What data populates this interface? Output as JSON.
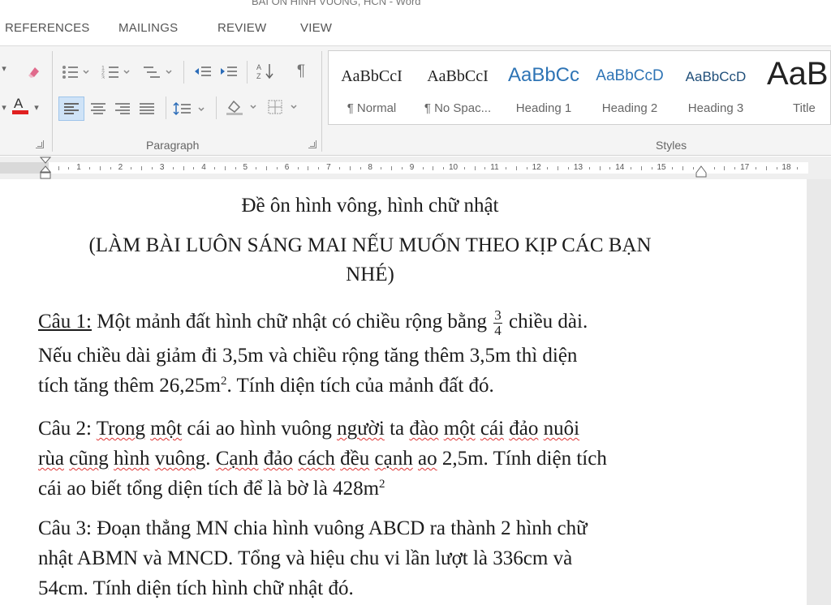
{
  "window": {
    "title": "BÀI ÔN HÌNH VUÔNG, HCN - Word"
  },
  "tabs": [
    "REFERENCES",
    "MAILINGS",
    "REVIEW",
    "VIEW"
  ],
  "ribbon": {
    "paragraph_label": "Paragraph",
    "styles_label": "Styles",
    "pilcrow": "¶",
    "styles": [
      {
        "sample": "AaBbCcI",
        "name": "¶ Normal"
      },
      {
        "sample": "AaBbCcI",
        "name": "¶ No Spac..."
      },
      {
        "sample": "AaBbCc",
        "name": "Heading 1"
      },
      {
        "sample": "AaBbCcD",
        "name": "Heading 2"
      },
      {
        "sample": "AaBbCcD",
        "name": "Heading 3"
      },
      {
        "sample": "AaB",
        "name": "Title"
      }
    ]
  },
  "ruler": {
    "numbers": [
      "1",
      "2",
      "3",
      "4",
      "5",
      "6",
      "7",
      "8",
      "9",
      "10",
      "11",
      "12",
      "13",
      "14",
      "15",
      "16",
      "17",
      "18"
    ]
  },
  "document": {
    "title": "Đề ôn hình vông, hình chữ nhật",
    "subtitle_line1": "(LÀM BÀI LUÔN SÁNG MAI NẾU MUỐN THEO KỊP CÁC BẠN",
    "subtitle_line2": "NHÉ)",
    "q1": {
      "label": "Câu 1:",
      "l1_a": "Một mảnh đất hình chữ nhật có chiều rộng bằng",
      "frac_num": "3",
      "frac_den": "4",
      "l1_b": "chiều dài.",
      "l2": "Nếu chiều dài giảm đi 3,5m và chiều rộng tăng thêm 3,5m thì diện",
      "l3_a": "tích tăng thêm 26,25m",
      "l3_sup": "2",
      "l3_b": ". Tính diện tích của mảnh đất đó."
    },
    "q2": {
      "l1_label": "Câu 2:",
      "l1_w1": "Trong",
      "l1_w2": "một",
      "l1_w3": "cái ao hình vuông",
      "l1_w4": "người",
      "l1_w5": "ta",
      "l1_w6": "đào",
      "l1_w7": "một",
      "l1_w8": "cái",
      "l1_w9": "đảo",
      "l1_w10": "nuôi",
      "l2_w1": "rùa",
      "l2_w2": "cũng",
      "l2_w3": "hình",
      "l2_w4": "vuông",
      "l2_p1": ".",
      "l2_w5": "Cạnh",
      "l2_w6": "đảo",
      "l2_w7": "cách",
      "l2_w8": "đều",
      "l2_w9": "cạnh",
      "l2_w10": "ao",
      "l2_rest": "2,5m. Tính diện tích",
      "l3_a": "cái ao biết tổng diện tích để là bờ là 428m",
      "l3_sup": "2"
    },
    "q3": {
      "l1": "Câu 3: Đoạn thẳng MN chia hình vuông ABCD ra thành 2 hình chữ",
      "l2": "nhật ABMN và MNCD. Tổng và hiệu chu vi lần lượt là 336cm và",
      "l3": "54cm. Tính diện tích hình chữ nhật đó."
    }
  }
}
